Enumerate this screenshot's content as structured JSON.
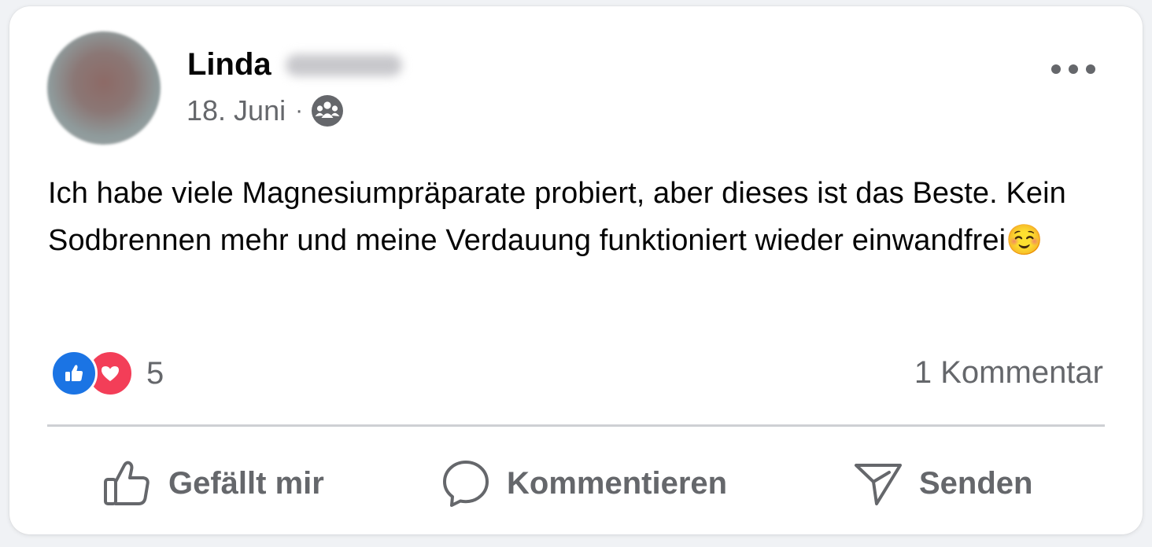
{
  "post": {
    "author_first_name": "Linda",
    "date": "18. Juni",
    "separator": "·",
    "audience_icon": "group-icon",
    "text": "Ich habe viele Magnesiumpräparate probiert, aber dieses ist das Beste. Kein Sodbrennen mehr und meine Verdauung funktioniert wieder einwandfrei☺️"
  },
  "reactions": {
    "types": [
      "like",
      "love"
    ],
    "count": "5",
    "comments_label": "1 Kommentar"
  },
  "actions": {
    "like_label": "Gefällt mir",
    "comment_label": "Kommentieren",
    "share_label": "Senden"
  },
  "colors": {
    "like_blue": "#1b74e4",
    "love_red": "#f33e58",
    "secondary_text": "#65676b",
    "primary_text": "#050505",
    "divider": "#ced0d4"
  }
}
